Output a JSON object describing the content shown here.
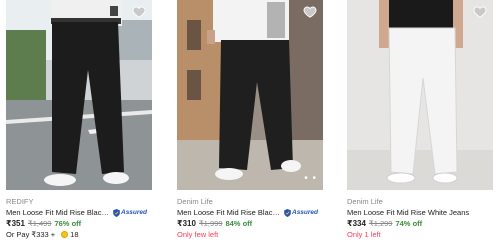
{
  "products": [
    {
      "brand": "REDIFY",
      "title": "Men Loose Fit Mid Rise Black Je...",
      "assured": "Assured",
      "price": "₹351",
      "mrp": "₹1,499",
      "discount": "76% off",
      "pay_with_coins": "Or Pay ₹333 +",
      "coin_count": "18",
      "jeans_color": "#1c1c1c"
    },
    {
      "brand": "Denim Life",
      "title": "Men Loose Fit Mid Rise Black Je...",
      "assured": "Assured",
      "price": "₹310",
      "mrp": "₹1,999",
      "discount": "84% off",
      "stock_note": "Only few left",
      "jeans_color": "#1f1f1f"
    },
    {
      "brand": "Denim Life",
      "title": "Men Loose Fit Mid Rise White Jeans",
      "price": "₹334",
      "mrp": "₹1,299",
      "discount": "74% off",
      "stock_note": "Only 1 left",
      "jeans_color": "#f4f4f4"
    }
  ],
  "icons": {
    "wishlist": "heart-icon",
    "assured": "shield-icon",
    "coin": "supercoin-icon"
  },
  "colors": {
    "discount": "#388e3c",
    "stock": "#ff3a5c",
    "assured": "#2455b8",
    "muted": "#878787"
  }
}
